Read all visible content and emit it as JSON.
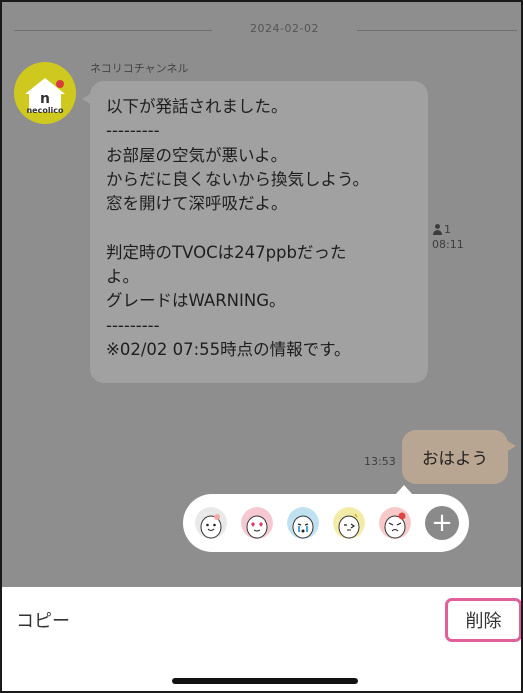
{
  "chat": {
    "date_separator": "2024-02-02",
    "incoming": {
      "sender_name": "ネコリコチャンネル",
      "avatar_text": "necolico",
      "lines": [
        "以下が発話されました。",
        "---------",
        "お部屋の空気が悪いよ。",
        "からだに良くないから換気しよう。",
        "窓を開けて深呼吸だよ。",
        "",
        "判定時のTVOCは247ppbだった",
        "よ。",
        "グレードはWARNING。",
        "---------",
        "※02/02 07:55時点の情報です。"
      ],
      "read_count": "1",
      "time": "08:11"
    },
    "outgoing": {
      "text": "おはよう",
      "time": "13:53"
    }
  },
  "reactions": {
    "items": [
      "sticker-smile-icon",
      "sticker-heart-eyes-icon",
      "sticker-cry-icon",
      "sticker-wink-icon",
      "sticker-angry-icon"
    ],
    "add_label": "+"
  },
  "actions": {
    "copy_label": "コピー",
    "delete_label": "削除"
  },
  "colors": {
    "highlight_border": "#e0609b",
    "outgoing_bubble": "#b9a692",
    "avatar_bg": "#cfc91f"
  }
}
